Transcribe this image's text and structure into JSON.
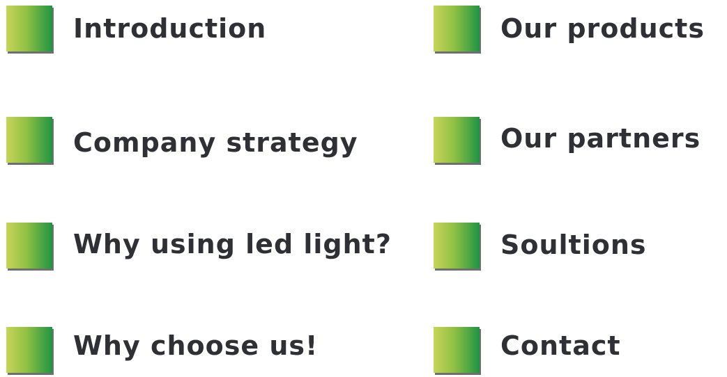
{
  "menu": {
    "items": [
      {
        "label": "Introduction"
      },
      {
        "label": "Company strategy"
      },
      {
        "label": "Why using led light?"
      },
      {
        "label": "Why choose us!"
      },
      {
        "label": "Our products"
      },
      {
        "label": "Our partners"
      },
      {
        "label": "Soultions"
      },
      {
        "label": "Contact"
      }
    ]
  },
  "colors": {
    "text": "#2e3035",
    "square_gradient_start": "#c7d45a",
    "square_gradient_mid": "#8fc043",
    "square_gradient_end": "#1f9443",
    "square_shadow": "#6f6f6f"
  }
}
